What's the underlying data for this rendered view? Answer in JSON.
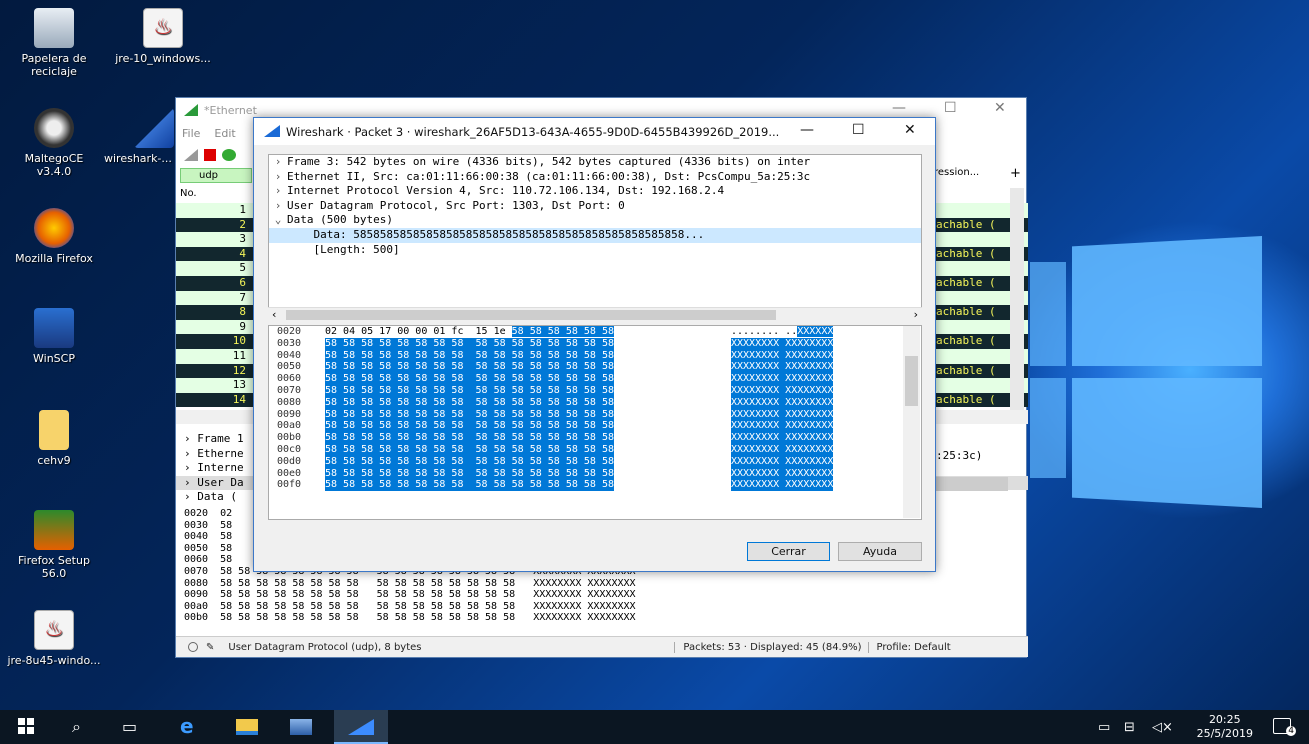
{
  "desktop": {
    "icons": [
      {
        "label": "Papelera de reciclaje",
        "name": "recycle-bin-icon"
      },
      {
        "label": "jre-10_windows...",
        "name": "java-icon"
      },
      {
        "label": "MaltegoCE v3.4.0",
        "name": "maltego-icon"
      },
      {
        "label": "wireshark-...",
        "name": "wireshark-icon"
      },
      {
        "label": "Mozilla Firefox",
        "name": "firefox-icon"
      },
      {
        "label": "WinSCP",
        "name": "winscp-icon"
      },
      {
        "label": "cehv9",
        "name": "folder-icon"
      },
      {
        "label": "Firefox Setup 56.0",
        "name": "firefox-setup-icon"
      },
      {
        "label": "jre-8u45-windo...",
        "name": "java-icon"
      }
    ]
  },
  "main": {
    "title": "*Ethernet",
    "menu": [
      "File",
      "Edit"
    ],
    "filter": "udp",
    "col_no": "No.",
    "expression": "ression...",
    "plus": "+",
    "rows": [
      "1",
      "2",
      "3",
      "4",
      "5",
      "6",
      "7",
      "8",
      "9",
      "10",
      "11",
      "12",
      "13",
      "14"
    ],
    "row_rest": "achable (",
    "detail": [
      "Frame 1",
      "Etherne",
      "Interne",
      "User Da",
      "Data ("
    ],
    "detail_right": ":25:3c)",
    "hex_lines": [
      "0020  02",
      "0030  58",
      "0040  58",
      "0050  58",
      "0060  58",
      "0070  58 58 58 58 58 58 58 58   58 58 58 58 58 58 58 58   XXXXXXXX XXXXXXXX",
      "0080  58 58 58 58 58 58 58 58   58 58 58 58 58 58 58 58   XXXXXXXX XXXXXXXX",
      "0090  58 58 58 58 58 58 58 58   58 58 58 58 58 58 58 58   XXXXXXXX XXXXXXXX",
      "00a0  58 58 58 58 58 58 58 58   58 58 58 58 58 58 58 58   XXXXXXXX XXXXXXXX",
      "00b0  58 58 58 58 58 58 58 58   58 58 58 58 58 58 58 58   XXXXXXXX XXXXXXXX"
    ],
    "status_text": "User Datagram Protocol (udp), 8 bytes",
    "status_packets": "Packets: 53 · Displayed: 45 (84.9%)",
    "status_profile": "Profile: Default"
  },
  "dialog": {
    "title": "Wireshark · Packet 3 · wireshark_26AF5D13-643A-4655-9D0D-6455B439926D_2019...",
    "tree": [
      {
        "arrow": ">",
        "text": "Frame 3: 542 bytes on wire (4336 bits), 542 bytes captured (4336 bits) on inter"
      },
      {
        "arrow": ">",
        "text": "Ethernet II, Src: ca:01:11:66:00:38 (ca:01:11:66:00:38), Dst: PcsCompu_5a:25:3c"
      },
      {
        "arrow": ">",
        "text": "Internet Protocol Version 4, Src: 110.72.106.134, Dst: 192.168.2.4"
      },
      {
        "arrow": ">",
        "text": "User Datagram Protocol, Src Port: 1303, Dst Port: 0"
      },
      {
        "arrow": "v",
        "text": "Data (500 bytes)"
      },
      {
        "arrow": "",
        "text": "    Data: 58585858585858585858585858585858585858585858585858..."
      },
      {
        "arrow": "",
        "text": "    [Length: 500]"
      }
    ],
    "hex_first": {
      "off": "0020",
      "bytes": "02 04 05 17 00 00 01 fc  15 1e ",
      "hl_bytes": "58 58 58 58 58 58",
      "ascii": "........ ..",
      "hl_ascii": "XXXXXX"
    },
    "hex_offsets": [
      "0030",
      "0040",
      "0050",
      "0060",
      "0070",
      "0080",
      "0090",
      "00a0",
      "00b0",
      "00c0",
      "00d0",
      "00e0",
      "00f0"
    ],
    "hex_bytes": "58 58 58 58 58 58 58 58  58 58 58 58 58 58 58 58",
    "hex_ascii": "XXXXXXXX XXXXXXXX",
    "btn_close": "Cerrar",
    "btn_help": "Ayuda"
  },
  "taskbar": {
    "time": "20:25",
    "date": "25/5/2019",
    "notif_count": "4"
  }
}
